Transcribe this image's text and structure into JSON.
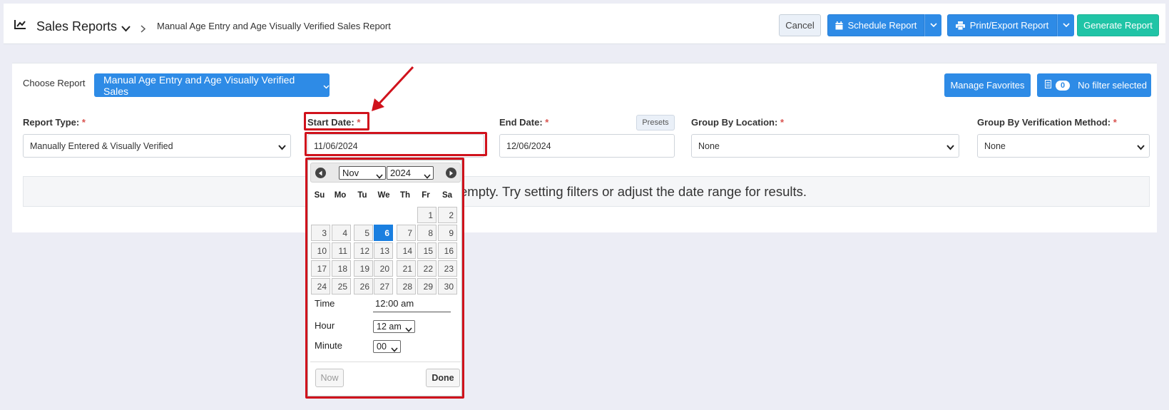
{
  "header": {
    "app_title": "Sales Reports",
    "breadcrumb": "Manual Age Entry and Age Visually Verified Sales Report",
    "cancel": "Cancel",
    "schedule": "Schedule Report",
    "print_export": "Print/Export Report",
    "generate": "Generate Report"
  },
  "toolbar": {
    "choose_label": "Choose Report",
    "report_selected": "Manual Age Entry and Age Visually Verified Sales",
    "manage_favorites": "Manage Favorites",
    "filter_count": "0",
    "filter_label": "No filter selected"
  },
  "filters": {
    "report_type": {
      "label": "Report Type:",
      "value": "Manually Entered & Visually Verified"
    },
    "start_date": {
      "label": "Start Date:",
      "value": "11/06/2024"
    },
    "end_date": {
      "label": "End Date:",
      "value": "12/06/2024"
    },
    "presets": "Presets",
    "group_location": {
      "label": "Group By Location:",
      "value": "None"
    },
    "group_verification": {
      "label": "Group By Verification Method:",
      "value": "None"
    },
    "required_mark": "*"
  },
  "empty_message": "empty. Try setting filters or adjust the date range for results.",
  "datepicker": {
    "month": "Nov",
    "year": "2024",
    "weekdays": [
      "Su",
      "Mo",
      "Tu",
      "We",
      "Th",
      "Fr",
      "Sa"
    ],
    "selected_day": 6,
    "time_label": "Time",
    "time_value": "12:00 am",
    "hour_label": "Hour",
    "hour_value": "12 am",
    "minute_label": "Minute",
    "minute_value": "00",
    "now": "Now",
    "done": "Done"
  },
  "colors": {
    "primary": "#2e8be6",
    "teal": "#20c4a6",
    "highlight": "#d0121c",
    "selected_day": "#1a7fe0"
  },
  "icons": [
    "chart-line-icon",
    "chevron-down-icon",
    "chevron-right-icon",
    "calendar-icon",
    "printer-icon",
    "filter-icon",
    "arrow-left-circle-icon",
    "arrow-right-circle-icon"
  ]
}
